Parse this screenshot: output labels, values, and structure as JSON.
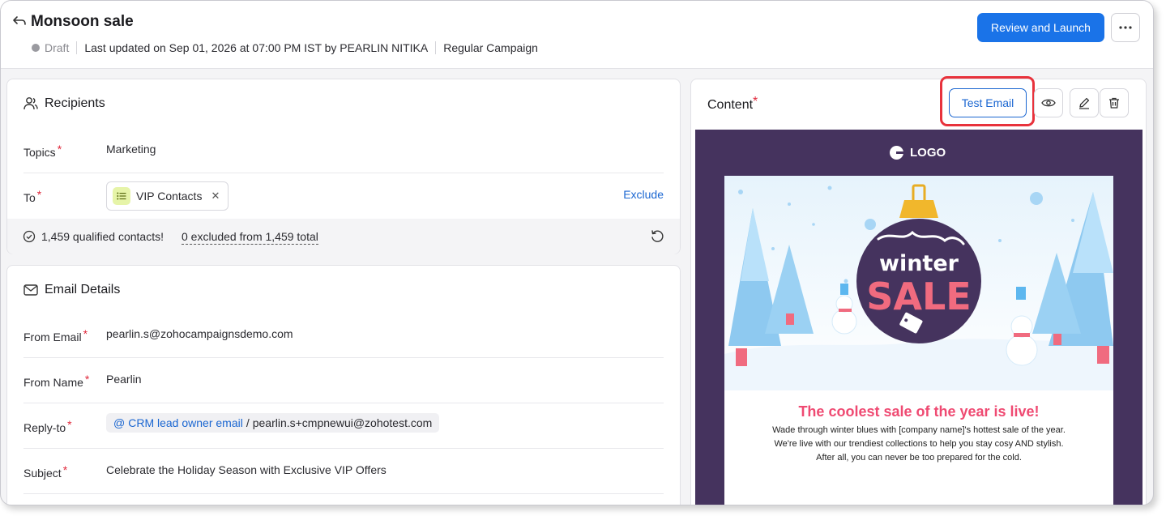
{
  "header": {
    "title": "Monsoon sale",
    "status": "Draft",
    "last_updated": "Last updated on Sep 01, 2026 at 07:00 PM IST by PEARLIN NITIKA",
    "campaign_type": "Regular Campaign",
    "launch_label": "Review and Launch"
  },
  "recipients": {
    "title": "Recipients",
    "topics_label": "Topics",
    "topics_value": "Marketing",
    "to_label": "To",
    "list_name": "VIP Contacts",
    "exclude_label": "Exclude",
    "qualified": "1,459 qualified contacts!",
    "excluded": "0 excluded from 1,459 total"
  },
  "email_details": {
    "title": "Email Details",
    "from_email_label": "From Email",
    "from_email": "pearlin.s@zohocampaignsdemo.com",
    "from_name_label": "From Name",
    "from_name": "Pearlin",
    "reply_to_label": "Reply-to",
    "reply_to_crm": "CRM lead owner email",
    "reply_to_sep": "/",
    "reply_to_email": "pearlin.s+cmpnewui@zohotest.com",
    "subject_label": "Subject",
    "subject": "Celebrate the Holiday Season with Exclusive VIP Offers"
  },
  "content": {
    "title": "Content",
    "test_email_label": "Test Email",
    "preview": {
      "logo": "LOGO",
      "ornament_line1": "winter",
      "ornament_line2": "SALE",
      "headline": "The coolest sale of the year is live!",
      "body": "Wade through winter blues with [company name]'s hottest sale of the year. We're live with our trendiest collections to help you stay cosy AND stylish. After all, you can never be too prepared for the cold."
    }
  },
  "colors": {
    "primary": "#1a73e8",
    "link": "#1a66d1",
    "required": "#e0283b",
    "preview_bg": "#45335e",
    "headline": "#ef4a72",
    "highlight": "#e8323c"
  }
}
